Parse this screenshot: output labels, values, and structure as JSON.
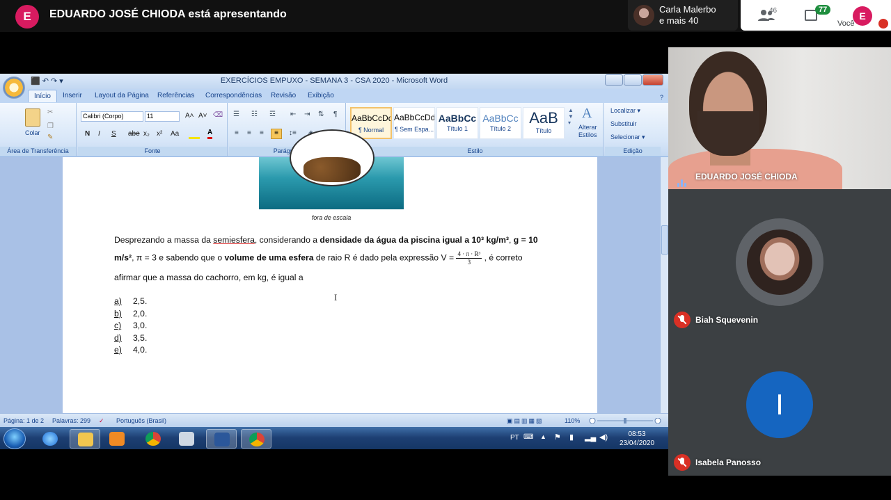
{
  "meet": {
    "presenter_initial": "E",
    "presenting_text": "EDUARDO JOSÉ CHIODA está apresentando",
    "active_speaker": {
      "name_line1": "Carla Malerbo",
      "name_line2": "e mais 40"
    },
    "people_count": "46",
    "chat_count": "77",
    "self_initial": "E",
    "self_label": "Você",
    "accent": "#d81b60"
  },
  "word": {
    "qat": "⬛ ↶ ↷ ▾",
    "title": "EXERCÍCIOS EMPUXO - SEMANA 3 - CSA 2020 - Microsoft Word",
    "tabs": [
      "Início",
      "Inserir",
      "Layout da Página",
      "Referências",
      "Correspondências",
      "Revisão",
      "Exibição"
    ],
    "ribbon": {
      "clipboard": {
        "paste_label": "Colar",
        "group": "Área de Transferência"
      },
      "font": {
        "name": "Calibri (Corpo)",
        "size": "11",
        "group": "Fonte",
        "grow": "A˄",
        "shrink": "A˅",
        "bold": "N",
        "italic": "I",
        "underline": "S",
        "strike": "abe",
        "sub": "x₂",
        "sup": "x²",
        "case": "Aa"
      },
      "paragraph": {
        "group": "Parágrafo"
      },
      "styles": {
        "group": "Estilo",
        "items": [
          {
            "sample": "AaBbCcDd",
            "name": "¶ Normal"
          },
          {
            "sample": "AaBbCcDd",
            "name": "¶ Sem Espa..."
          },
          {
            "sample": "AaBbCc",
            "name": "Título 1"
          },
          {
            "sample": "AaBbCc",
            "name": "Título 2"
          },
          {
            "sample": "AaB",
            "name": "Título"
          }
        ],
        "change_label_1": "Alterar",
        "change_label_2": "Estilos"
      },
      "editing": {
        "group": "Edição",
        "find": "Localizar ▾",
        "replace": "Substituir",
        "select": "Selecionar ▾"
      }
    },
    "document": {
      "caption": "fora de escala",
      "p1_a": "Desprezando a massa da ",
      "p1_b": "semiesfera",
      "p1_c": ", considerando a ",
      "p1_d": "densidade da água da piscina igual a 10³ kg/m³",
      "p1_e": ", ",
      "p1_f": "g = 10",
      "p2_a": "m/s²",
      "p2_b": ",  π = 3  e sabendo que o ",
      "p2_c": "volume de uma esfera",
      "p2_d": " de raio R é dado pela expressão  V = ",
      "frac_num": "4 · π · R³",
      "frac_den": "3",
      "p2_e": " , é correto",
      "p3": "afirmar que a massa do cachorro, em kg, é igual a",
      "options": [
        {
          "letter": "a)",
          "value": "2,5."
        },
        {
          "letter": "b)",
          "value": "2,0."
        },
        {
          "letter": "c)",
          "value": "3,0."
        },
        {
          "letter": "d)",
          "value": "3,5."
        },
        {
          "letter": "e)",
          "value": "4,0."
        }
      ]
    },
    "status": {
      "page": "Página: 1 de 2",
      "words": "Palavras: 299",
      "language": "Português (Brasil)",
      "zoom": "110%"
    }
  },
  "taskbar": {
    "lang": "PT",
    "time": "08:53",
    "date": "23/04/2020"
  },
  "participants": {
    "main": {
      "name": "EDUARDO JOSÉ CHIODA"
    },
    "second": {
      "name": "Biah Squevenin"
    },
    "third": {
      "name": "Isabela Panosso",
      "initial": "I"
    }
  }
}
